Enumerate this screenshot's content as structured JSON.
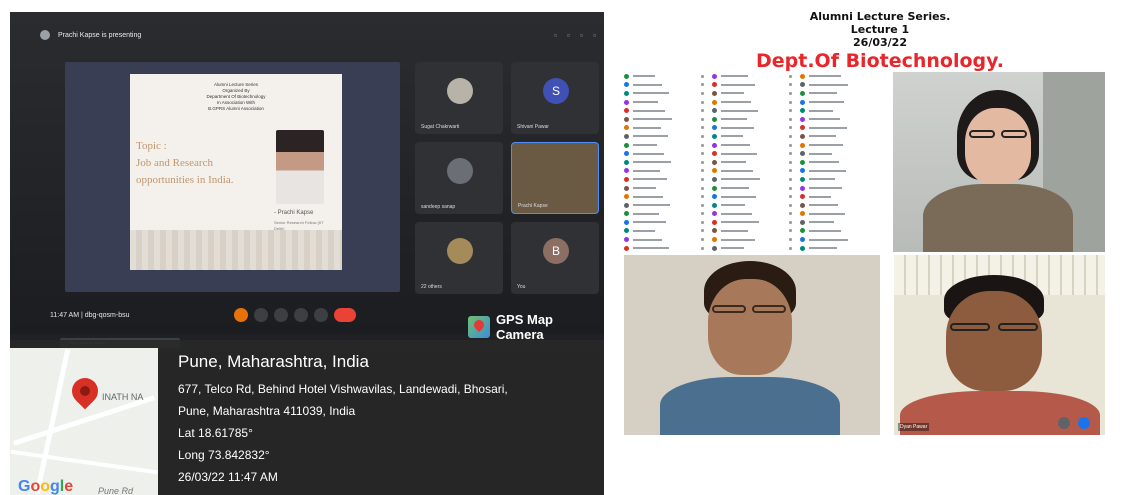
{
  "meet": {
    "presenting_text": "Prachi Kapse is presenting",
    "clock_text": "11:47 AM | dbg-qosm-bsu",
    "taskbar_search": "Type here to search"
  },
  "slide": {
    "head_lines": [
      "Alumni Lecture Series",
      "Organized By",
      "Department Of Biotechnology",
      "In Association With",
      "B.GPRS Alumni Association"
    ],
    "topic_lines": [
      "Topic :",
      "Job and Research",
      "opportunities in India."
    ],
    "speaker_name": "- Prachi Kapse",
    "speaker_role": "Senior Research Fellow (IIT Delhi)"
  },
  "tiles": [
    {
      "name": "Sugat Chakrwarti",
      "initial": ""
    },
    {
      "name": "Shivani Pawar",
      "initial": "S"
    },
    {
      "name": "sandeep sanap",
      "initial": ""
    },
    {
      "name": "Prachi Kapse",
      "initial": ""
    },
    {
      "name": "22 others",
      "initial": ""
    },
    {
      "name": "You",
      "initial": "B"
    }
  ],
  "gps": {
    "app_name": "GPS Map Camera",
    "city": "Pune, Maharashtra, India",
    "address_line1": "677, Telco Rd, Behind Hotel Vishwavilas, Landewadi, Bhosari,",
    "address_line2": "Pune, Maharashtra 411039, India",
    "lat": "Lat 18.61785°",
    "long": "Long 73.842832°",
    "datetime": "26/03/22 11:47 AM",
    "map_area_label": "INATH NA",
    "map_road_label": "Pune Rd",
    "google": [
      "G",
      "o",
      "o",
      "g",
      "l",
      "e"
    ]
  },
  "collage": {
    "title_line1": "Alumni Lecture Series.",
    "title_line2": "Lecture 1",
    "title_line3": "26/03/22",
    "title_line4": "Dept.Of Biotechnology.",
    "accent_color": "#e8262b"
  },
  "videos": [
    {
      "name": ""
    },
    {
      "name": ""
    },
    {
      "name": "Dyan Pawar"
    }
  ]
}
